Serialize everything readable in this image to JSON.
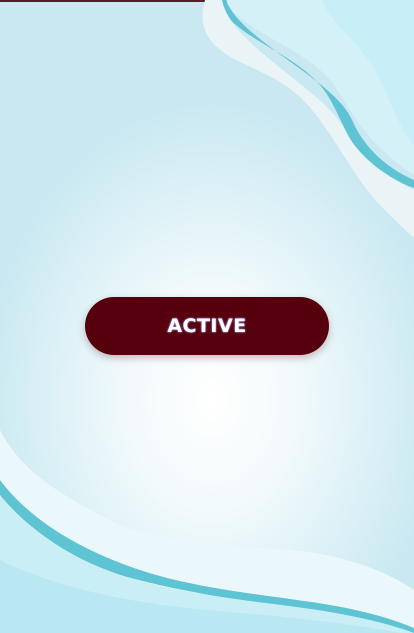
{
  "button": {
    "label": "ACTIVE",
    "color": "#55000c",
    "text_color": "#ffffff"
  },
  "background": {
    "base": "#c9e8f1",
    "center_glow": "#ffffff",
    "wave_dark": "#5ec3d2",
    "wave_light": "#e8f7fa",
    "top_edge": "#5a1a2a"
  }
}
